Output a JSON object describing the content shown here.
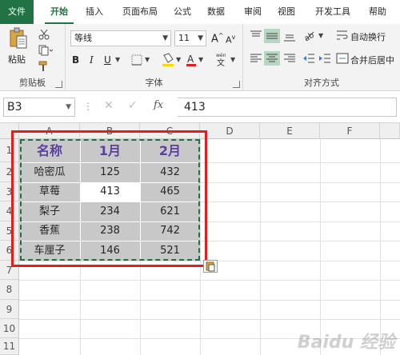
{
  "tabs": [
    "文件",
    "开始",
    "插入",
    "页面布局",
    "公式",
    "数据",
    "审阅",
    "视图",
    "开发工具",
    "帮助"
  ],
  "ribbon": {
    "clipboard": {
      "paste_label": "粘贴",
      "group_label": "剪贴板"
    },
    "font": {
      "font_name": "等线",
      "font_size": "11",
      "group_label": "字体"
    },
    "alignment": {
      "wrap_label": "自动换行",
      "merge_label": "合并后居中",
      "group_label": "对齐方式"
    }
  },
  "formula_bar": {
    "name_box": "B3",
    "formula": "413"
  },
  "grid": {
    "columns": [
      "A",
      "B",
      "C",
      "D",
      "E",
      "F"
    ],
    "rows": [
      "1",
      "2",
      "3",
      "4",
      "5",
      "6",
      "7",
      "8",
      "9",
      "10",
      "11"
    ],
    "headers": [
      "名称",
      "1月",
      "2月"
    ],
    "data": [
      [
        "哈密瓜",
        "125",
        "432"
      ],
      [
        "草莓",
        "413",
        "465"
      ],
      [
        "梨子",
        "234",
        "621"
      ],
      [
        "香蕉",
        "238",
        "742"
      ],
      [
        "车厘子",
        "146",
        "521"
      ]
    ]
  },
  "watermark": "Baidu 经验",
  "colors": {
    "accent": "#217346",
    "highlight": "#e02020",
    "header_text": "#5b3fa0"
  }
}
